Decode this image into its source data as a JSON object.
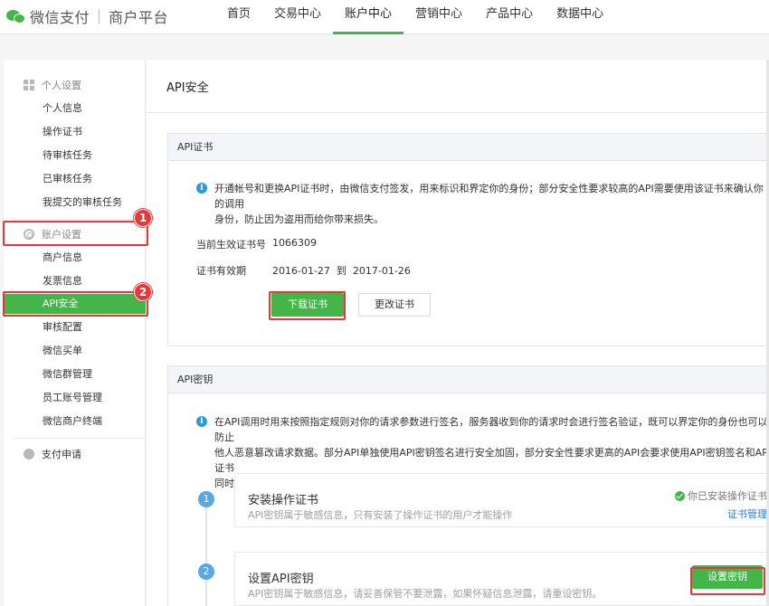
{
  "header": {
    "brand_name": "微信支付",
    "brand_subtitle": "商户平台",
    "nav": [
      {
        "label": "首页"
      },
      {
        "label": "交易中心"
      },
      {
        "label": "账户中心"
      },
      {
        "label": "营销中心"
      },
      {
        "label": "产品中心"
      },
      {
        "label": "数据中心"
      }
    ],
    "active_nav": "账户中心"
  },
  "sidebar": {
    "group_personal": "个人设置",
    "personal_items": [
      {
        "label": "个人信息"
      },
      {
        "label": "操作证书"
      },
      {
        "label": "待审核任务"
      },
      {
        "label": "已审核任务"
      },
      {
        "label": "我提交的审核任务"
      }
    ],
    "group_account": "账户设置",
    "account_items": [
      {
        "label": "商户信息"
      },
      {
        "label": "发票信息"
      },
      {
        "label": "API安全"
      },
      {
        "label": "审核配置"
      },
      {
        "label": "微信买单"
      },
      {
        "label": "微信群管理"
      },
      {
        "label": "员工账号管理"
      },
      {
        "label": "微信商户终端"
      }
    ],
    "group_pay": "支付申请",
    "active_item": "API安全"
  },
  "main": {
    "title": "API安全",
    "cert_panel": {
      "heading": "API证书",
      "info": "开通帐号和更换API证书时，由微信支付签发，用来标识和界定你的身份；部分安全性要求较高的API需要使用该证书来确认你的调用\n身份，防止因为盗用而给你带来损失。",
      "cert_no_label": "当前生效证书号",
      "cert_no_value": "1066309",
      "validity_label": "证书有效期",
      "validity_value": "2016-01-27  到  2017-01-26",
      "download_button": "下载证书",
      "change_button": "更改证书"
    },
    "key_panel": {
      "heading": "API密钥",
      "info": "在API调用时用来按照指定规则对你的请求参数进行签名，服务器收到你的请求时会进行签名验证，既可以界定你的身份也可以防止\n他人恶意篡改请求数据。部分API单独使用API密钥签名进行安全加固，部分安全性要求更高的API会要求使用API密钥签名和API证书\n同时进行安全加固。",
      "steps": [
        {
          "num": "1",
          "title": "安装操作证书",
          "desc": "API密钥属于敏感信息，只有安装了操作证书的用户才能操作",
          "status": "你已安装操作证书",
          "link": "证书管理"
        },
        {
          "num": "2",
          "title": "设置API密钥",
          "desc": "API密钥属于敏感信息，请妥善保管不要泄露，如果怀疑信息泄露，请重设密钥。",
          "button": "设置密钥"
        }
      ]
    }
  },
  "annotations": [
    {
      "label": "1"
    },
    {
      "label": "2"
    }
  ],
  "colors": {
    "brand_green": "#44b549",
    "annotation_red": "#e4393c",
    "info_blue": "#2a9bd8",
    "step_blue": "#59a8e6",
    "link_blue": "#2a7ed3"
  }
}
